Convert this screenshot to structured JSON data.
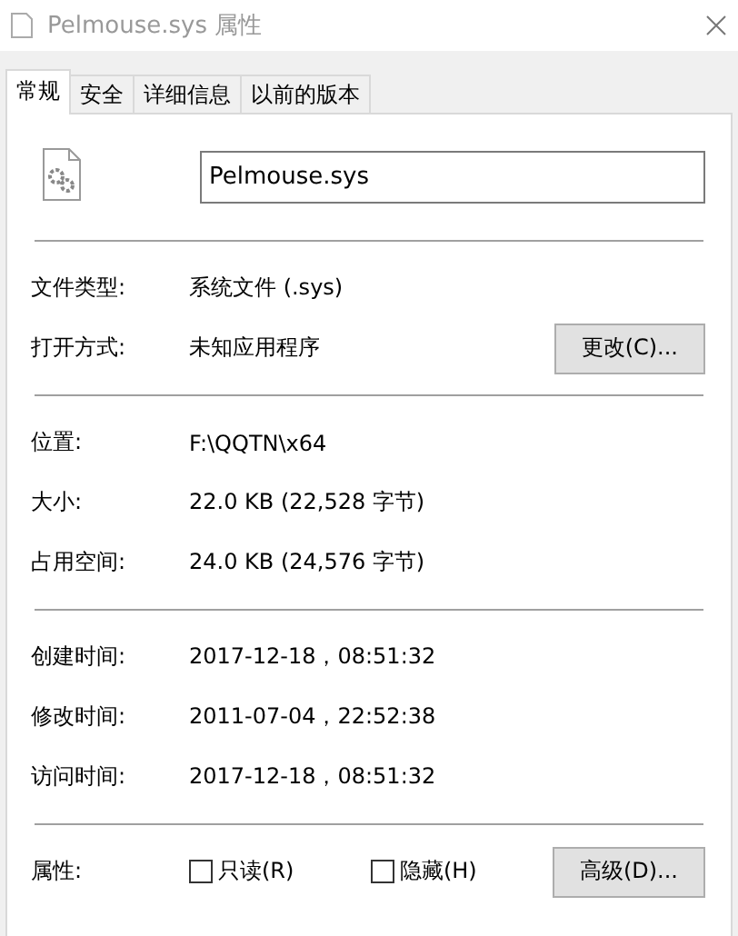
{
  "window": {
    "title": "Pelmouse.sys 属性",
    "active": false
  },
  "tabs": [
    {
      "label": "常规",
      "selected": true
    },
    {
      "label": "安全",
      "selected": false
    },
    {
      "label": "详细信息",
      "selected": false
    },
    {
      "label": "以前的版本",
      "selected": false
    }
  ],
  "file_name": "Pelmouse.sys",
  "sections": [
    [
      {
        "label": "文件类型:",
        "value": "系统文件 (.sys)"
      },
      {
        "label": "打开方式:",
        "value": "未知应用程序",
        "button": "更改(C)..."
      }
    ],
    [
      {
        "label": "位置:",
        "value": "F:\\QQTN\\x64"
      },
      {
        "label": "大小:",
        "value": "22.0 KB (22,528 字节)"
      },
      {
        "label": "占用空间:",
        "value": "24.0 KB (24,576 字节)"
      }
    ],
    [
      {
        "label": "创建时间:",
        "value": "2017-12-18，08:51:32"
      },
      {
        "label": "修改时间:",
        "value": "2011-07-04，22:52:38"
      },
      {
        "label": "访问时间:",
        "value": "2017-12-18，08:51:32"
      }
    ]
  ],
  "attributes": {
    "label": "属性:",
    "checkboxes": [
      {
        "label": "只读(R)",
        "checked": false
      },
      {
        "label": "隐藏(H)",
        "checked": false
      }
    ],
    "button": "高级(D)..."
  }
}
